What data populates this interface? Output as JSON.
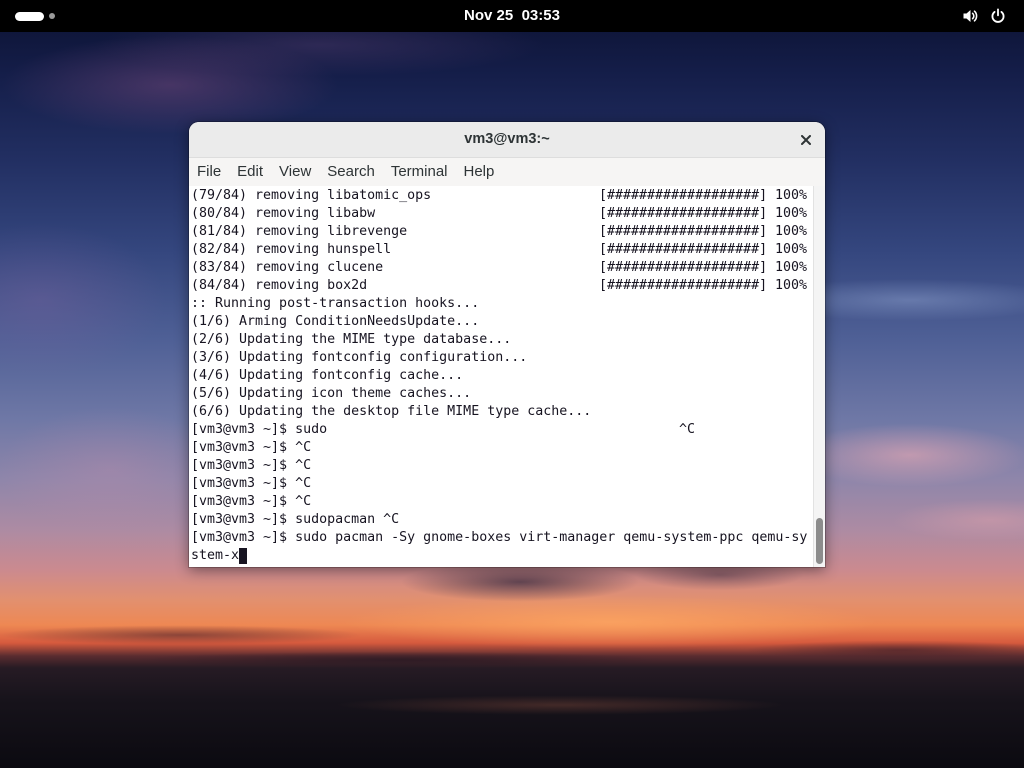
{
  "topbar": {
    "clock": "Nov 25  03:53"
  },
  "window": {
    "title": "vm3@vm3:~",
    "menu": [
      "File",
      "Edit",
      "View",
      "Search",
      "Terminal",
      "Help"
    ]
  },
  "terminal": {
    "removals": [
      {
        "text": "(79/84) removing libatomic_ops",
        "bar": "[###################]",
        "percent": "100%"
      },
      {
        "text": "(80/84) removing libabw",
        "bar": "[###################]",
        "percent": "100%"
      },
      {
        "text": "(81/84) removing librevenge",
        "bar": "[###################]",
        "percent": "100%"
      },
      {
        "text": "(82/84) removing hunspell",
        "bar": "[###################]",
        "percent": "100%"
      },
      {
        "text": "(83/84) removing clucene",
        "bar": "[###################]",
        "percent": "100%"
      },
      {
        "text": "(84/84) removing box2d",
        "bar": "[###################]",
        "percent": "100%"
      }
    ],
    "hooks": [
      ":: Running post-transaction hooks...",
      "(1/6) Arming ConditionNeedsUpdate...",
      "(2/6) Updating the MIME type database...",
      "(3/6) Updating fontconfig configuration...",
      "(4/6) Updating fontconfig cache...",
      "(5/6) Updating icon theme caches...",
      "(6/6) Updating the desktop file MIME type cache..."
    ],
    "sudo_line": {
      "text": "[vm3@vm3 ~]$ sudo",
      "tail": "^C"
    },
    "prompt_lines": [
      "[vm3@vm3 ~]$ ^C",
      "[vm3@vm3 ~]$ ^C",
      "[vm3@vm3 ~]$ ^C",
      "[vm3@vm3 ~]$ ^C",
      "[vm3@vm3 ~]$ sudopacman ^C",
      "[vm3@vm3 ~]$ sudo pacman -Sy gnome-boxes virt-manager qemu-system-ppc qemu-sy"
    ],
    "current_input_wrap": "stem-x"
  },
  "icons": {
    "activities": "workspace-indicator",
    "volume": "volume-icon",
    "power": "power-icon",
    "close": "close-icon",
    "cursor": "block-cursor"
  },
  "colors": {
    "topbar": "#000000",
    "terminal_background": "#ffffff",
    "terminal_text": "#171421",
    "titlebar": "#ebebeb"
  }
}
